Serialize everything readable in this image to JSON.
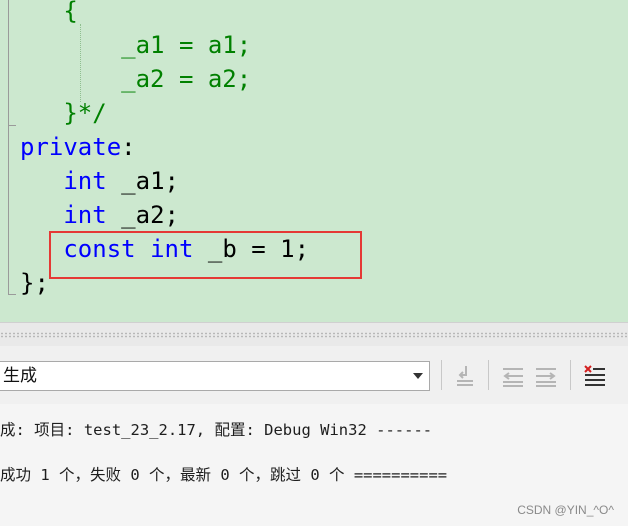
{
  "editor": {
    "lines": [
      {
        "indent": "   ",
        "tokens": [
          {
            "t": "{",
            "c": "comment"
          }
        ]
      },
      {
        "indent": "       ",
        "tokens": [
          {
            "t": "_a1 = a1;",
            "c": "comment"
          }
        ]
      },
      {
        "indent": "       ",
        "tokens": [
          {
            "t": "_a2 = a2;",
            "c": "comment"
          }
        ]
      },
      {
        "indent": "   ",
        "tokens": [
          {
            "t": "}*/",
            "c": "comment"
          }
        ]
      },
      {
        "indent": "",
        "tokens": [
          {
            "t": "private",
            "c": "keyword"
          },
          {
            "t": ":",
            "c": "plain"
          }
        ]
      },
      {
        "indent": "   ",
        "tokens": [
          {
            "t": "int",
            "c": "keyword"
          },
          {
            "t": " _a1;",
            "c": "plain"
          }
        ]
      },
      {
        "indent": "   ",
        "tokens": [
          {
            "t": "int",
            "c": "keyword"
          },
          {
            "t": " _a2;",
            "c": "plain"
          }
        ]
      },
      {
        "indent": "   ",
        "tokens": [
          {
            "t": "const",
            "c": "keyword"
          },
          {
            "t": " ",
            "c": "plain"
          },
          {
            "t": "int",
            "c": "keyword"
          },
          {
            "t": " _b = 1;",
            "c": "plain"
          }
        ]
      },
      {
        "indent": "",
        "tokens": [
          {
            "t": "};",
            "c": "plain"
          }
        ]
      }
    ],
    "colors": {
      "background": "#cce8cf",
      "keyword": "#0000ff",
      "comment": "#008000",
      "plain": "#000000",
      "highlight": "#e53935"
    }
  },
  "output": {
    "source_value": "生成",
    "lines": [
      "成: 项目: test_23_2.17, 配置: Debug Win32 ------",
      "成功 1 个，失败 0 个，最新 0 个，跳过 0 个 =========="
    ],
    "toolbar_icons": [
      "goto-source-icon",
      "previous-message-icon",
      "next-message-icon",
      "clear-all-icon"
    ]
  },
  "watermark": "CSDN @YIN_^O^"
}
